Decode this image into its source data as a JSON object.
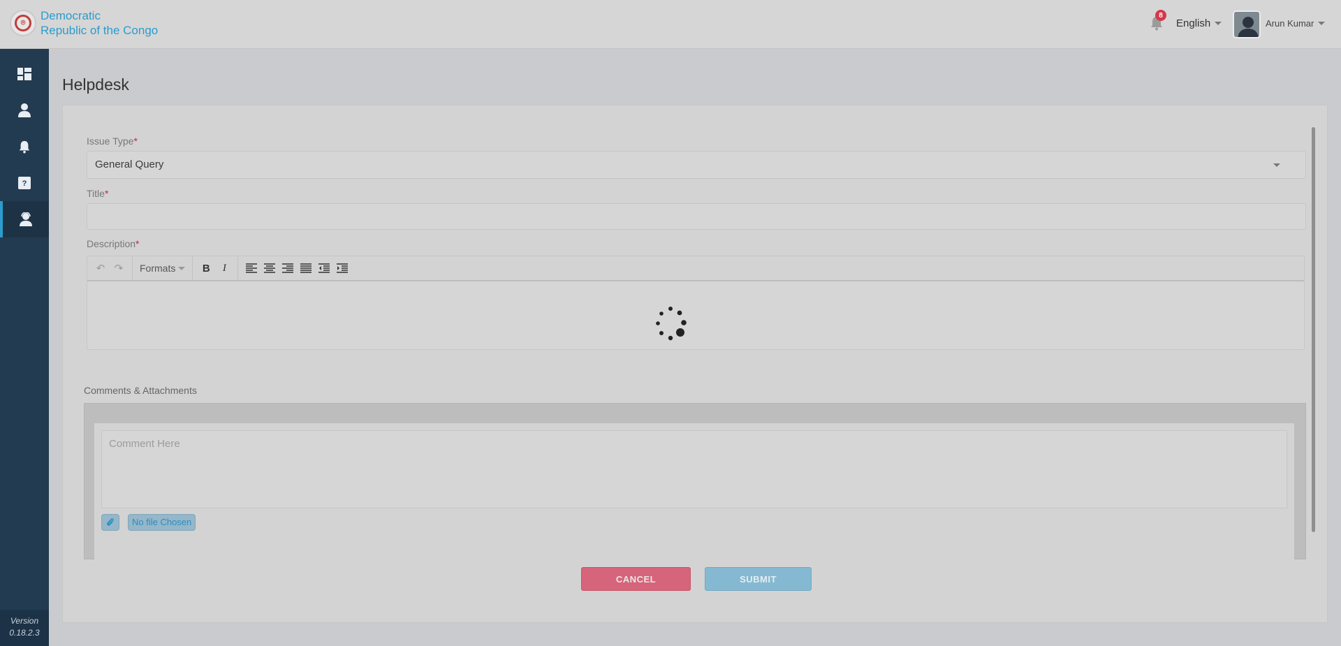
{
  "header": {
    "brand_line1": "Democratic",
    "brand_line2": "Republic of the Congo",
    "notification_count": "8",
    "language": "English",
    "user_name": "Arun Kumar"
  },
  "sidebar": {
    "items": [
      {
        "name": "dashboard-icon",
        "active": false
      },
      {
        "name": "user-icon",
        "active": false
      },
      {
        "name": "bell-icon",
        "active": false
      },
      {
        "name": "help-icon",
        "active": false
      },
      {
        "name": "support-agent-icon",
        "active": true
      }
    ],
    "version_label": "Version",
    "version_number": "0.18.2.3"
  },
  "page": {
    "title": "Helpdesk"
  },
  "form": {
    "issue_type_label": "Issue Type",
    "issue_type_value": "General Query",
    "title_label": "Title",
    "title_value": "",
    "description_label": "Description",
    "required_mark": "*",
    "formats_label": "Formats",
    "comments_label": "Comments & Attachments",
    "comment_placeholder": "Comment Here",
    "file_status": "No file Chosen",
    "cancel_label": "CANCEL",
    "submit_label": "SUBMIT"
  },
  "colors": {
    "accent": "#2b9ccc",
    "sidebar": "#233b50",
    "cancel": "#d6647a",
    "submit": "#85b9d1",
    "badge": "#d33a4a"
  }
}
